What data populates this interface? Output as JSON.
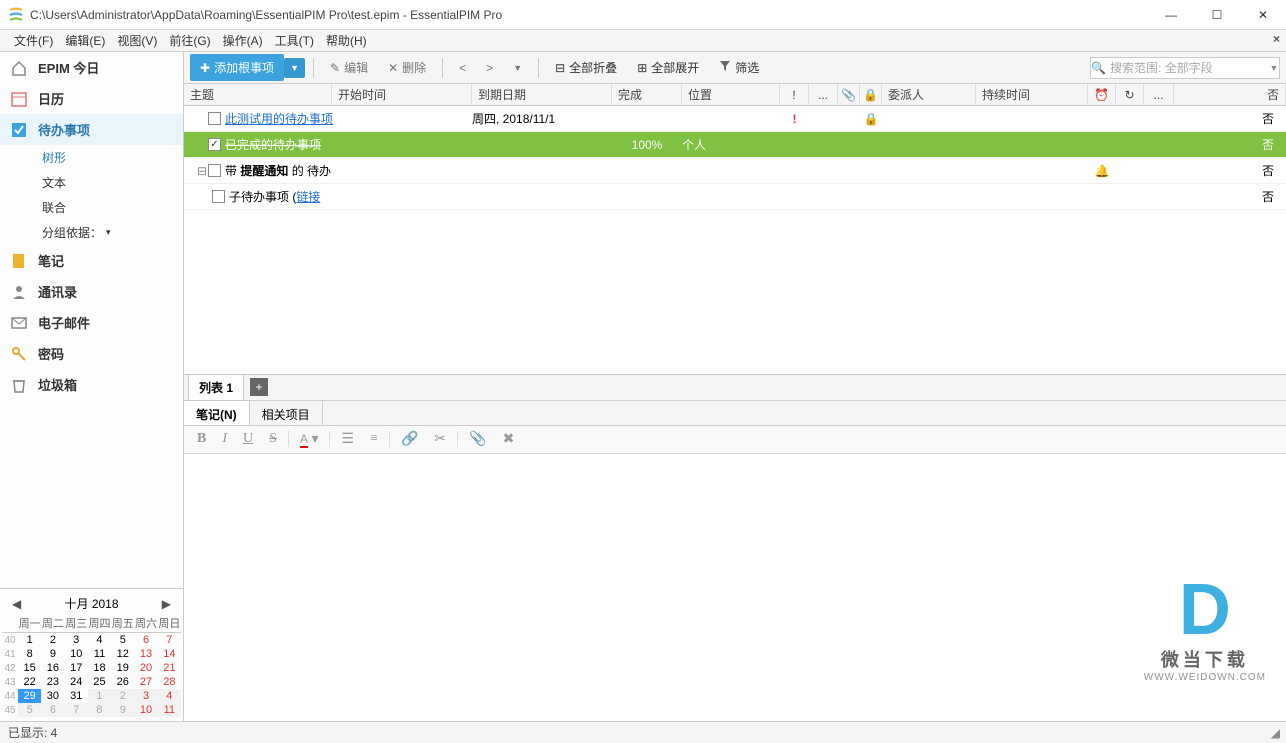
{
  "window": {
    "title": "C:\\Users\\Administrator\\AppData\\Roaming\\EssentialPIM Pro\\test.epim - EssentialPIM Pro"
  },
  "menu": {
    "file": "文件(F)",
    "edit": "编辑(E)",
    "view": "视图(V)",
    "goto": "前往(G)",
    "action": "操作(A)",
    "tools": "工具(T)",
    "help": "帮助(H)"
  },
  "sidebar": {
    "today": "EPIM 今日",
    "calendar": "日历",
    "todo": "待办事项",
    "sub": {
      "tree": "树形",
      "text": "文本",
      "combined": "联合",
      "groupby": "分组依据："
    },
    "notes": "笔记",
    "contacts": "通讯录",
    "mail": "电子邮件",
    "passwords": "密码",
    "trash": "垃圾箱"
  },
  "toolbar": {
    "add": "添加根事项",
    "edit": "编辑",
    "delete": "删除",
    "collapse_all": "全部折叠",
    "expand_all": "全部展开",
    "filter": "筛选",
    "search_placeholder": "搜索范围: 全部字段"
  },
  "columns": {
    "subject": "主题",
    "start": "开始时间",
    "due": "到期日期",
    "done": "完成",
    "location": "位置",
    "priority": "!",
    "misc": "...",
    "delegate": "委派人",
    "duration": "持续时间",
    "more": "...",
    "no_col": "否"
  },
  "tasks": [
    {
      "indent": 0,
      "checked": false,
      "subject": "此测试用的待办事项",
      "link": true,
      "due": "周四, 2018/11/1",
      "done": "",
      "location": "",
      "priority": "!",
      "lock": true,
      "bell": false,
      "no_val": "否"
    },
    {
      "indent": 0,
      "checked": true,
      "subject": "已完成的待办事项",
      "link": false,
      "done": "100%",
      "location": "个人",
      "priority": "",
      "lock": false,
      "bell": false,
      "no_val": "否",
      "selected": true
    },
    {
      "indent": 0,
      "checked": false,
      "has_children": true,
      "subject_pre": "带 ",
      "subject_bold": "提醒通知",
      "subject_post": " 的 待办",
      "link": false,
      "done": "",
      "location": "",
      "priority": "",
      "lock": false,
      "bell": true,
      "no_val": "否"
    },
    {
      "indent": 1,
      "checked": false,
      "subject_pre": "子待办事项 (",
      "subject_link": "链接",
      "subject_post2": ")",
      "link": false,
      "done": "",
      "location": "",
      "priority": "",
      "lock": false,
      "bell": false,
      "no_val": "否"
    }
  ],
  "list_tabs": {
    "tab1": "列表 1"
  },
  "detail": {
    "notes": "笔记(N)",
    "related": "相关项目"
  },
  "calendar": {
    "title": "十月   2018",
    "weekdays": [
      "周一",
      "周二",
      "周三",
      "周四",
      "周五",
      "周六",
      "周日"
    ],
    "weeks": [
      {
        "num": 40,
        "days": [
          1,
          2,
          3,
          4,
          5,
          6,
          7
        ]
      },
      {
        "num": 41,
        "days": [
          8,
          9,
          10,
          11,
          12,
          13,
          14
        ]
      },
      {
        "num": 42,
        "days": [
          15,
          16,
          17,
          18,
          19,
          20,
          21
        ]
      },
      {
        "num": 43,
        "days": [
          22,
          23,
          24,
          25,
          26,
          27,
          28
        ]
      },
      {
        "num": 44,
        "days": [
          29,
          30,
          31,
          1,
          2,
          3,
          4
        ],
        "other_from": 3
      },
      {
        "num": 45,
        "days": [
          5,
          6,
          7,
          8,
          9,
          10,
          11
        ],
        "all_other": true
      }
    ],
    "today": 29
  },
  "status": {
    "shown": "已显示: 4"
  },
  "watermark": {
    "name": "微当下载",
    "url": "WWW.WEIDOWN.COM"
  }
}
